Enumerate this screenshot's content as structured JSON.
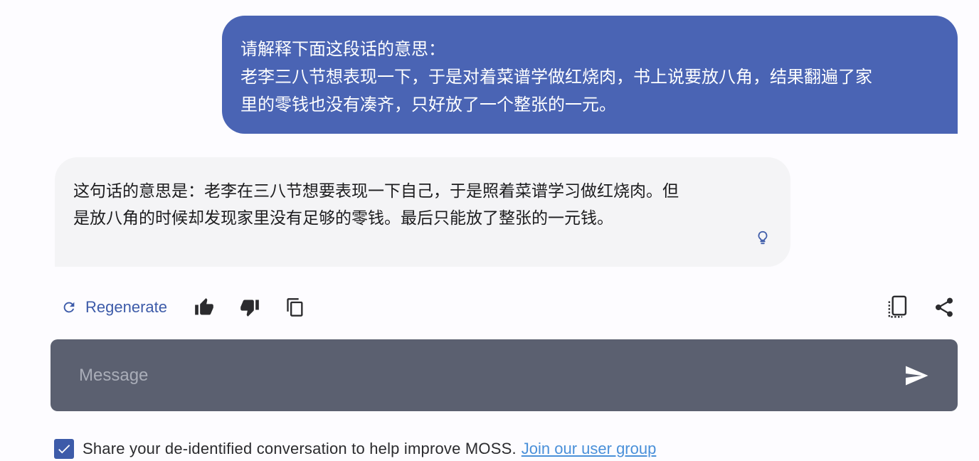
{
  "conversation": {
    "user_message": {
      "lines": [
        "请解释下面这段话的意思：",
        "老李三八节想表现一下，于是对着菜谱学做红烧肉，书上说要放八角，结果翻遍了家",
        "里的零钱也没有凑齐，只好放了一个整张的一元。"
      ]
    },
    "assistant_message": {
      "lines": [
        "这句话的意思是：老李在三八节想要表现一下自己，于是照着菜谱学习做红烧肉。但",
        "是放八角的时候却发现家里没有足够的零钱。最后只能放了整张的一元钱。"
      ],
      "hint_icon": "lightbulb-icon"
    }
  },
  "actions": {
    "regenerate_label": "Regenerate",
    "icons": [
      "refresh-icon",
      "thumbs-up-icon",
      "thumbs-down-icon",
      "copy-icon",
      "screenshot-icon",
      "share-icon"
    ]
  },
  "composer": {
    "placeholder": "Message",
    "value": "",
    "send_icon": "send-icon"
  },
  "consent": {
    "checked": true,
    "text": "Share your de-identified conversation to help improve MOSS.",
    "link_text": "Join our user group"
  },
  "colors": {
    "accent": "#3d5ba9",
    "user_bubble": "#4a64b4",
    "assistant_bubble": "#f4f4f6",
    "composer_bg": "#5b6070",
    "link": "#4a90d9"
  }
}
